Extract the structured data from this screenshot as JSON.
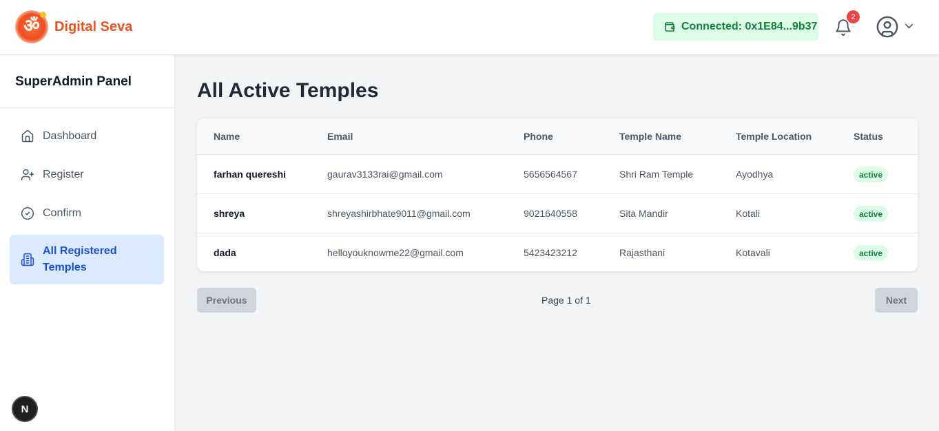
{
  "header": {
    "brand": "Digital Seva",
    "logo_glyph": "ॐ",
    "wallet_status": "Connected: 0x1E84...9b37",
    "notification_count": "2"
  },
  "sidebar": {
    "title": "SuperAdmin Panel",
    "items": [
      {
        "label": "Dashboard",
        "icon": "home-icon"
      },
      {
        "label": "Register",
        "icon": "user-plus-icon"
      },
      {
        "label": "Confirm",
        "icon": "check-circle-icon"
      },
      {
        "label": "All Registered Temples",
        "icon": "building-icon",
        "active": true
      }
    ],
    "bottom_badge": "N"
  },
  "main": {
    "title": "All Active Temples",
    "columns": [
      "Name",
      "Email",
      "Phone",
      "Temple Name",
      "Temple Location",
      "Status"
    ],
    "rows": [
      {
        "name": "farhan quereshi",
        "email": "gaurav3133rai@gmail.com",
        "phone": "5656564567",
        "temple": "Shri Ram Temple",
        "location": "Ayodhya",
        "status": "active"
      },
      {
        "name": "shreya",
        "email": "shreyashirbhate9011@gmail.com",
        "phone": "9021640558",
        "temple": "Sita Mandir",
        "location": "Kotali",
        "status": "active"
      },
      {
        "name": "dada",
        "email": "helloyouknowme22@gmail.com",
        "phone": "5423423212",
        "temple": "Rajasthani",
        "location": "Kotavali",
        "status": "active"
      }
    ],
    "pagination": {
      "previous": "Previous",
      "info": "Page 1 of 1",
      "next": "Next"
    }
  },
  "colors": {
    "brand": "#e8531f",
    "wallet_bg": "#dcfce7",
    "wallet_text": "#15803d",
    "active_nav_bg": "#dbeafe",
    "active_nav_text": "#1d4ed8",
    "badge": "#ef4444"
  }
}
